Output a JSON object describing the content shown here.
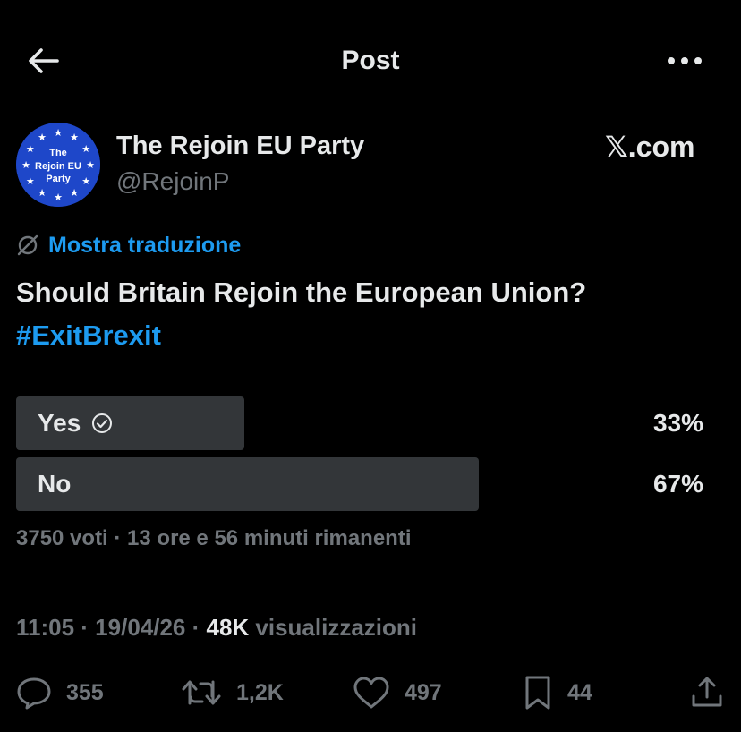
{
  "header": {
    "title": "Post"
  },
  "author": {
    "name": "The Rejoin EU Party",
    "handle": "@RejoinP",
    "avatar_text": [
      "The",
      "Rejoin EU",
      "Party"
    ],
    "avatar_color": "#1e47c9",
    "star_color": "#ffffff"
  },
  "source": "𝕏.com",
  "translate": {
    "label": "Mostra traduzione"
  },
  "post": {
    "text": "Should Britain Rejoin the European Union?",
    "hashtag": "#ExitBrexit"
  },
  "poll": {
    "options": [
      {
        "label": "Yes",
        "percent_text": "33%",
        "percent": 33,
        "selected": true
      },
      {
        "label": "No",
        "percent_text": "67%",
        "percent": 67,
        "selected": false
      }
    ],
    "meta": "3750 voti · 13 ore e 56 minuti rimanenti"
  },
  "timestamp": {
    "prefix": "11:05 · 19/04/26 · ",
    "views_count": "48K",
    "views_label": " visualizzazioni"
  },
  "actions": {
    "replies": "355",
    "reposts": "1,2K",
    "likes": "497",
    "bookmarks": "44"
  },
  "colors": {
    "background": "#000000",
    "text": "#e7e9ea",
    "muted": "#71767b",
    "link": "#1d9bf0",
    "poll_bar": "#333639"
  }
}
